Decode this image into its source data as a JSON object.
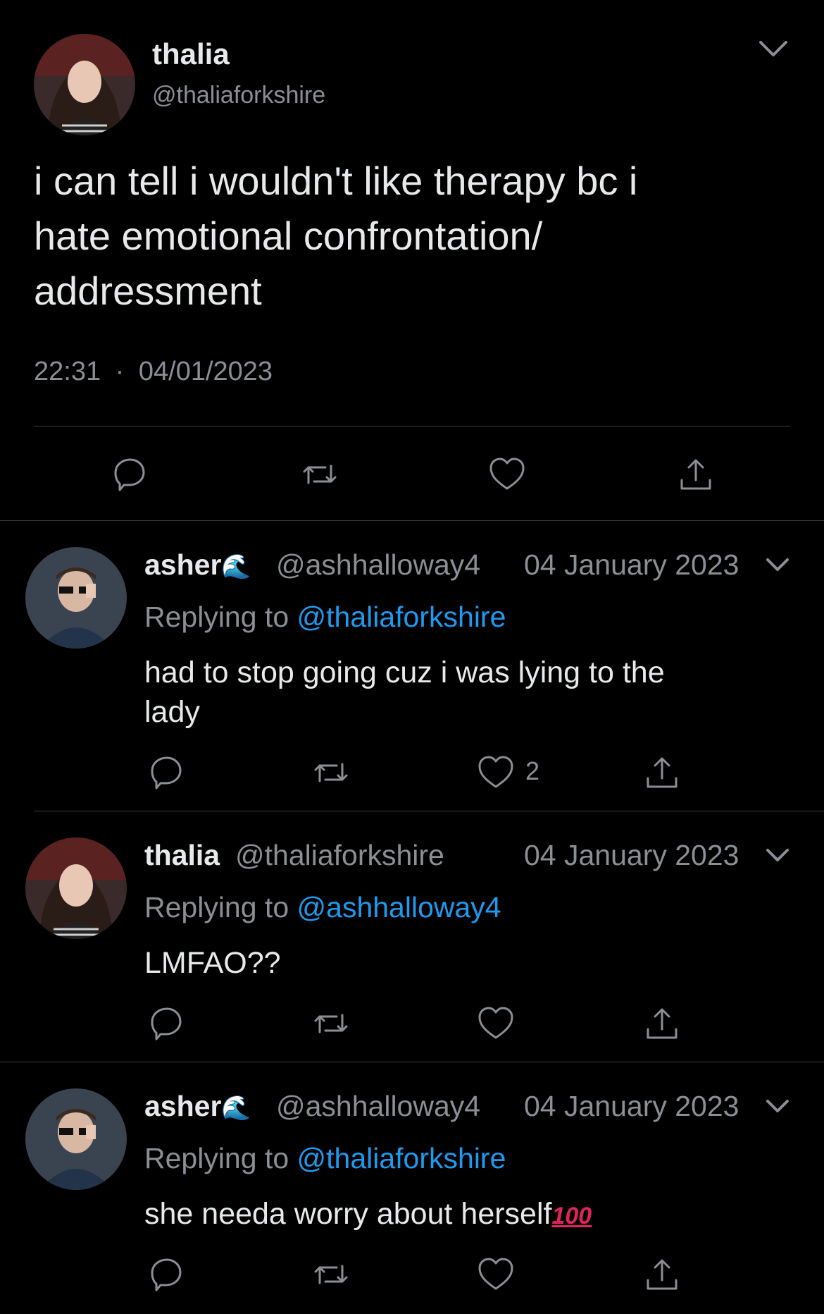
{
  "main_tweet": {
    "name": "thalia",
    "handle": "@thaliaforkshire",
    "text_lines": [
      "i can tell i wouldn't like therapy bc i",
      "hate emotional confrontation/",
      "addressment"
    ],
    "time": "22:31",
    "separator": "·",
    "date": "04/01/2023"
  },
  "replies": [
    {
      "name": "asher",
      "emoji": "🌊",
      "handle": "@ashhalloway4",
      "date": "04 January 2023",
      "replying_prefix": "Replying to",
      "replying_to": "@thaliaforkshire",
      "text_lines": [
        "had to stop going cuz i was lying to the",
        "lady"
      ],
      "like_count": "2"
    },
    {
      "name": "thalia",
      "handle": "@thaliaforkshire",
      "date": "04 January 2023",
      "replying_prefix": "Replying to",
      "replying_to": "@ashhalloway4",
      "text_lines": [
        "LMFAO??"
      ]
    },
    {
      "name": "asher",
      "emoji": "🌊",
      "handle": "@ashhalloway4",
      "date": "04 January 2023",
      "replying_prefix": "Replying to",
      "replying_to": "@thaliaforkshire",
      "text": "she needa worry about herself",
      "emoji_suffix": "100"
    }
  ],
  "icons": [
    "reply-icon",
    "retweet-icon",
    "like-icon",
    "share-icon",
    "chevron-down-icon"
  ],
  "colors": {
    "background": "#000000",
    "text": "#e7e9ea",
    "secondary": "#8b8f94",
    "link": "#1d9bf0",
    "divider": "#3a3d40"
  }
}
